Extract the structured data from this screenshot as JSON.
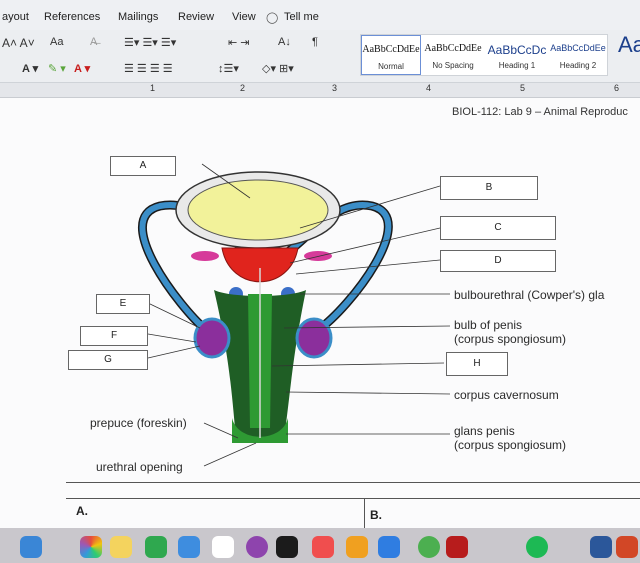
{
  "ribbon_tabs": [
    "ayout",
    "References",
    "Mailings",
    "Review",
    "View",
    "Tell me"
  ],
  "ribbon": {
    "font_size_label": "Aa",
    "sort_label": "A↓",
    "pilcrow": "¶",
    "styles": [
      {
        "sample": "AaBbCcDdEe",
        "name": "Normal"
      },
      {
        "sample": "AaBbCcDdEe",
        "name": "No Spacing"
      },
      {
        "sample": "AaBbCcDc",
        "name": "Heading 1"
      },
      {
        "sample": "AaBbCcDdEe",
        "name": "Heading 2"
      },
      {
        "sample": "Aa",
        "name": ""
      }
    ]
  },
  "ruler_numbers": [
    "1",
    "2",
    "3",
    "4",
    "5",
    "6"
  ],
  "document": {
    "title": "BIOL-112: Lab 9 – Animal Reproduc",
    "boxes": {
      "A": "A",
      "B": "B",
      "C": "C",
      "D": "D",
      "E": "E",
      "F": "F",
      "G": "G",
      "H": "H"
    },
    "labels": {
      "bulbourethral": "bulbourethral (Cowper's) gla",
      "bulb_penis_1": "bulb of penis",
      "bulb_penis_2": "(corpus spongiosum)",
      "corpus_cavernosum": "corpus cavernosum",
      "glans_1": "glans penis",
      "glans_2": "(corpus spongiosum)",
      "prepuce": "prepuce (foreskin)",
      "urethral_opening": "urethral opening"
    },
    "answers": {
      "a": "A.",
      "b": "B."
    }
  },
  "dock_icons": [
    "finder-icon",
    "photos-icon",
    "notes-icon",
    "numbers-icon",
    "keynote-icon",
    "music-icon",
    "podcasts-icon",
    "appletv-icon",
    "news-icon",
    "appstore-icon",
    "chrome-icon",
    "acrobat-icon",
    "settings-icon",
    "spotify-icon",
    "word-icon",
    "powerpoint-icon"
  ],
  "colors": {
    "bladder": "#f2f29a",
    "prostate": "#e0241d",
    "spongiosum": "#2e9a33",
    "cavernosum": "#1f5e25",
    "vas": "#3b8ec8",
    "testis": "#8b2f9c"
  }
}
